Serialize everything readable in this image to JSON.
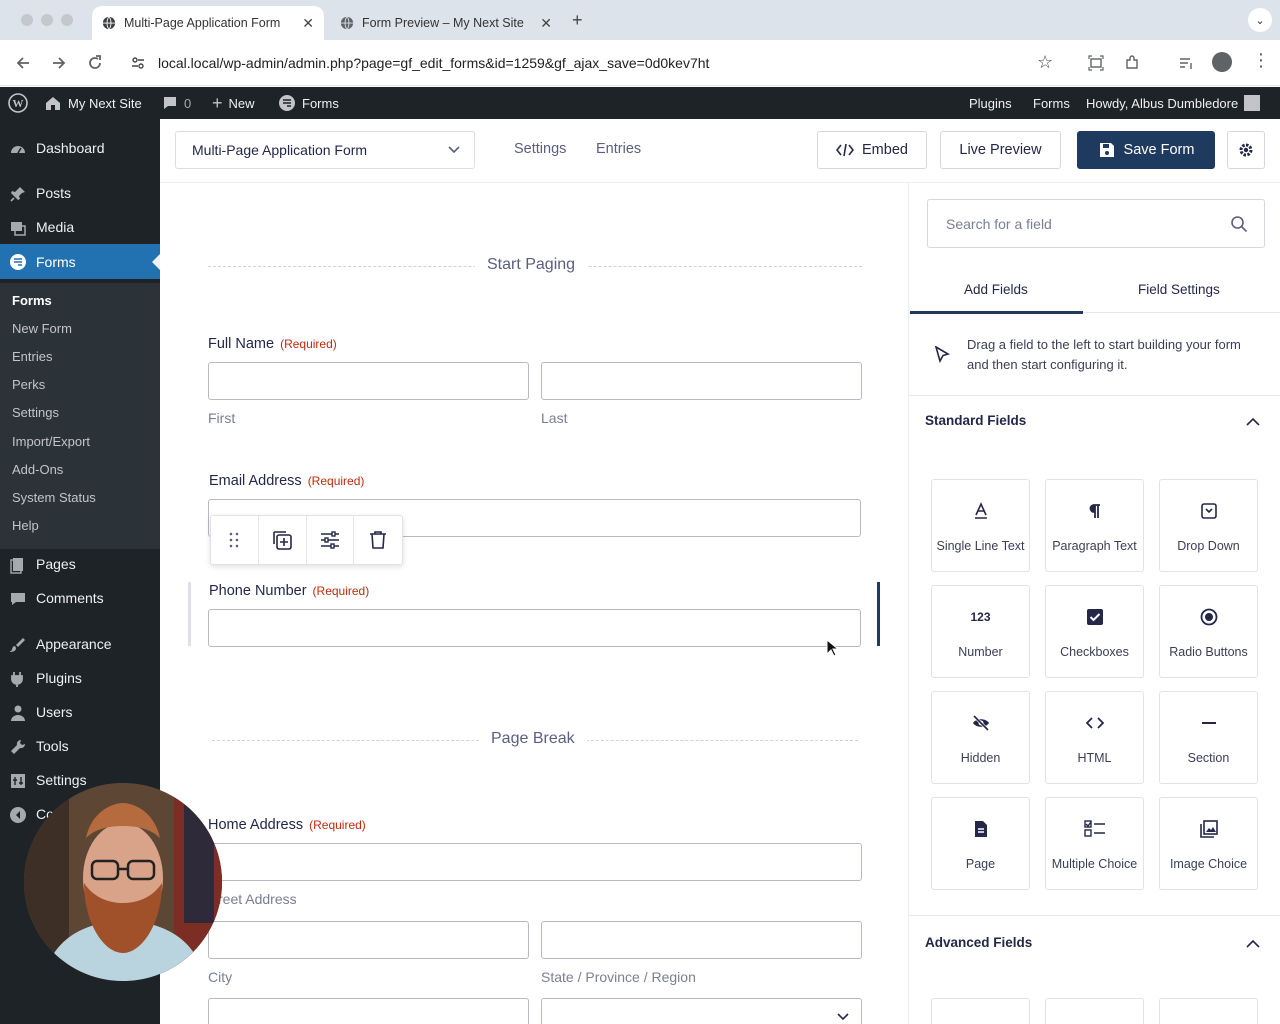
{
  "browser": {
    "tabs": [
      {
        "title": "Multi-Page Application Form"
      },
      {
        "title": "Form Preview – My Next Site"
      }
    ],
    "url": "local.local/wp-admin/admin.php?page=gf_edit_forms&id=1259&gf_ajax_save=0d0kev7ht"
  },
  "adminbar": {
    "site_name": "My Next Site",
    "comments_count": "0",
    "new_label": "New",
    "forms_label": "Forms",
    "right_plugins": "Plugins",
    "right_forms": "Forms",
    "howdy": "Howdy, Albus Dumbledore"
  },
  "sidebar": {
    "items": [
      {
        "label": "Dashboard",
        "icon": "dashboard-icon"
      },
      {
        "label": "Posts",
        "icon": "pin-icon"
      },
      {
        "label": "Media",
        "icon": "media-icon"
      },
      {
        "label": "Forms",
        "icon": "forms-icon"
      },
      {
        "label": "Pages",
        "icon": "pages-icon"
      },
      {
        "label": "Comments",
        "icon": "comments-icon"
      },
      {
        "label": "Appearance",
        "icon": "appearance-icon"
      },
      {
        "label": "Plugins",
        "icon": "plugins-icon"
      },
      {
        "label": "Users",
        "icon": "users-icon"
      },
      {
        "label": "Tools",
        "icon": "tools-icon"
      },
      {
        "label": "Settings",
        "icon": "settings-icon"
      },
      {
        "label": "Co",
        "icon": "collapse-icon"
      }
    ],
    "submenu": [
      "Forms",
      "New Form",
      "Entries",
      "Perks",
      "Settings",
      "Import/Export",
      "Add-Ons",
      "System Status",
      "Help"
    ]
  },
  "toolbar": {
    "form_name": "Multi-Page Application Form",
    "settings": "Settings",
    "entries": "Entries",
    "embed": "Embed",
    "live_preview": "Live Preview",
    "save": "Save Form"
  },
  "form": {
    "start_paging": "Start Paging",
    "page_break": "Page Break",
    "required": "(Required)",
    "full_name": {
      "label": "Full Name",
      "first": "First",
      "last": "Last"
    },
    "email": {
      "label": "Email Address"
    },
    "phone": {
      "label": "Phone Number"
    },
    "address": {
      "label": "Home Address",
      "street": "reet Address",
      "city": "City",
      "state": "State / Province / Region"
    }
  },
  "panel": {
    "search_placeholder": "Search for a field",
    "tab_add": "Add Fields",
    "tab_settings": "Field Settings",
    "hint": "Drag a field to the left to start building your form and then start configuring it.",
    "standard_title": "Standard Fields",
    "advanced_title": "Advanced Fields",
    "fields": [
      {
        "label": "Single Line Text",
        "icon": "single-line-text-icon"
      },
      {
        "label": "Paragraph Text",
        "icon": "paragraph-icon"
      },
      {
        "label": "Drop Down",
        "icon": "dropdown-icon"
      },
      {
        "label": "Number",
        "icon": "number-icon",
        "glyph": "123"
      },
      {
        "label": "Checkboxes",
        "icon": "checkbox-icon"
      },
      {
        "label": "Radio Buttons",
        "icon": "radio-icon"
      },
      {
        "label": "Hidden",
        "icon": "hidden-icon"
      },
      {
        "label": "HTML",
        "icon": "html-icon"
      },
      {
        "label": "Section",
        "icon": "section-icon"
      },
      {
        "label": "Page",
        "icon": "page-icon"
      },
      {
        "label": "Multiple Choice",
        "icon": "multiple-choice-icon"
      },
      {
        "label": "Image Choice",
        "icon": "image-choice-icon"
      }
    ]
  },
  "colors": {
    "wp_dark": "#1d2327",
    "wp_blue": "#2271b1",
    "save_button": "#1e3a5f",
    "required_red": "#c02b0a"
  }
}
